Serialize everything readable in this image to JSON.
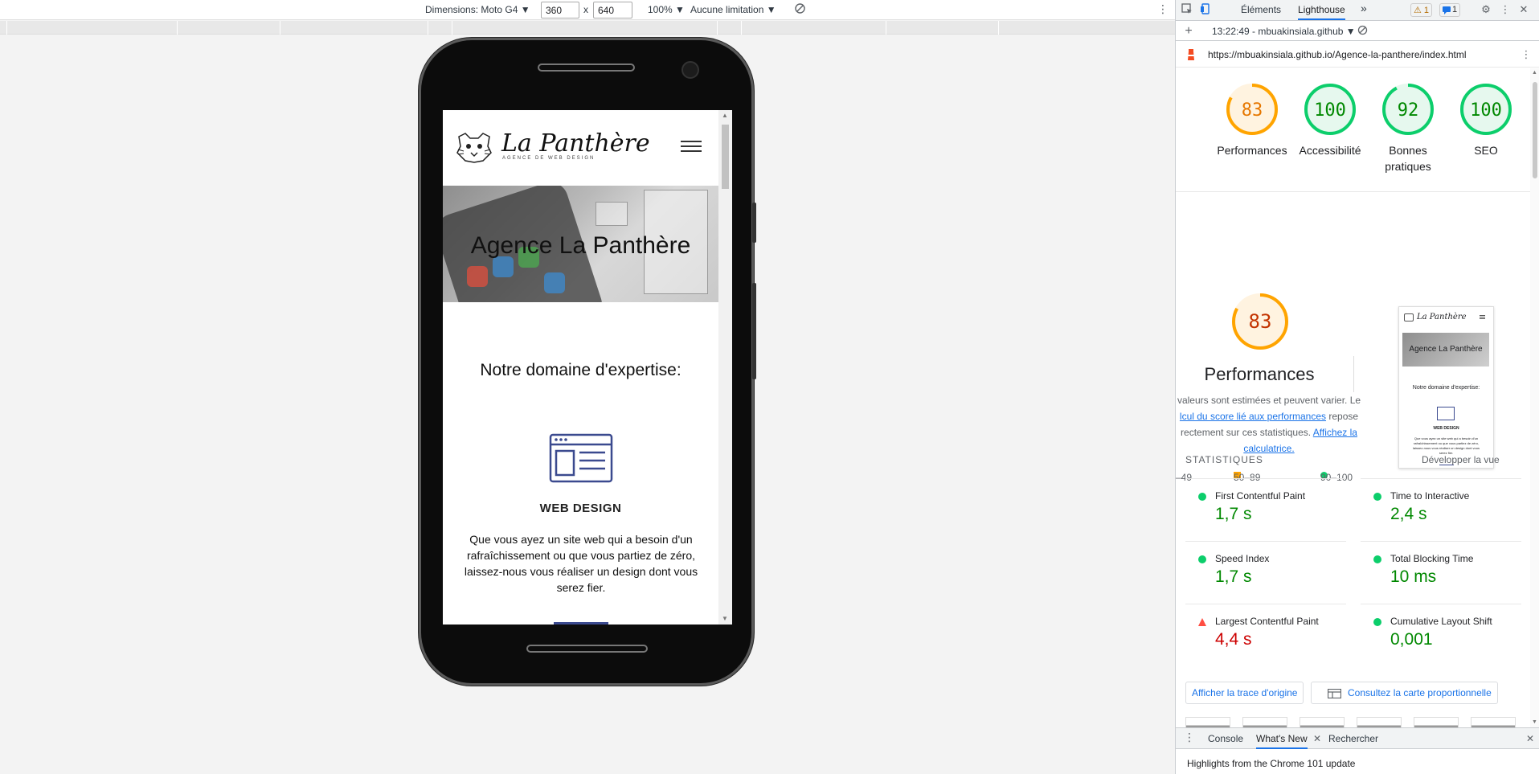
{
  "device_toolbar": {
    "dimensions_label": "Dimensions: Moto G4 ▼",
    "width_value": "360",
    "times": "x",
    "height_value": "640",
    "zoom": "100% ▼",
    "throttle": "Aucune limitation ▼"
  },
  "site": {
    "logo_title": "La Panthère",
    "logo_subtitle": "AGENCE DE WEB DESIGN",
    "hero_title": "Agence La Panthère",
    "expertise_title": "Notre domaine d'expertise:",
    "web_design_title": "WEB DESIGN",
    "web_design_text": "Que vous ayez un site web qui a besoin d'un rafraîchissement ou que vous partiez de zéro, laissez-nous vous réaliser un design dont vous serez fier."
  },
  "devtools": {
    "tabs": {
      "elements": "Éléments",
      "lighthouse": "Lighthouse",
      "more": "»"
    },
    "badges": {
      "warnings": "⚠ 1",
      "messages": "1"
    },
    "report_selector": "13:22:49 - mbuakinsiala.github ▼",
    "url": "https://mbuakinsiala.github.io/Agence-la-panthere/index.html",
    "scores": [
      {
        "label": "Performances",
        "value": "83",
        "color": "#e67700",
        "ring": "#ffa400",
        "fraction": 0.83
      },
      {
        "label": "Accessibilité",
        "value": "100",
        "color": "#008800",
        "ring": "#0cce6b",
        "fraction": 1.0
      },
      {
        "label": "Bonnes pratiques",
        "value": "92",
        "color": "#008800",
        "ring": "#0cce6b",
        "fraction": 0.92
      },
      {
        "label": "SEO",
        "value": "100",
        "color": "#008800",
        "ring": "#0cce6b",
        "fraction": 1.0
      }
    ],
    "perf": {
      "score": "83",
      "title": "Performances",
      "desc_1": "valeurs sont estimées et peuvent varier. Le",
      "desc_link_1": "lcul du score lié aux performances",
      "desc_2": "repose",
      "desc_3": "rectement sur ces statistiques.",
      "desc_link_2": "Affichez la calculatrice.",
      "legend_fail": "–49",
      "legend_avg": "50–89",
      "legend_pass": "90–100"
    },
    "thumbnail": {
      "logo": "La Panthère",
      "hero": "Agence La Panthère",
      "expertise": "Notre domaine d'expertise:",
      "web_design": "WEB DESIGN",
      "text": "Que vous ayez un site web qui a besoin d'un rafraîchissement ou que vous partiez de zéro, laissez-nous vous réaliser un design dont vous serez fier."
    },
    "stats_header": "STATISTIQUES",
    "stats_expand": "Développer la vue",
    "metrics": [
      {
        "name": "First Contentful Paint",
        "value": "1,7 s",
        "status": "pass"
      },
      {
        "name": "Time to Interactive",
        "value": "2,4 s",
        "status": "pass"
      },
      {
        "name": "Speed Index",
        "value": "1,7 s",
        "status": "pass"
      },
      {
        "name": "Total Blocking Time",
        "value": "10 ms",
        "status": "pass"
      },
      {
        "name": "Largest Contentful Paint",
        "value": "4,4 s",
        "status": "fail"
      },
      {
        "name": "Cumulative Layout Shift",
        "value": "0,001",
        "status": "pass"
      }
    ],
    "buttons": {
      "trace": "Afficher la trace d'origine",
      "treemap": "Consultez la carte proportionnelle"
    },
    "drawer": {
      "console": "Console",
      "whats_new": "What's New",
      "search": "Rechercher",
      "highlights": "Highlights from the Chrome 101 update"
    }
  },
  "colors": {
    "pass": "#0cce6b",
    "pass_text": "#008800",
    "average": "#ffa400",
    "fail": "#ff4e42",
    "fail_text": "#c00",
    "link": "#1a73e8"
  }
}
